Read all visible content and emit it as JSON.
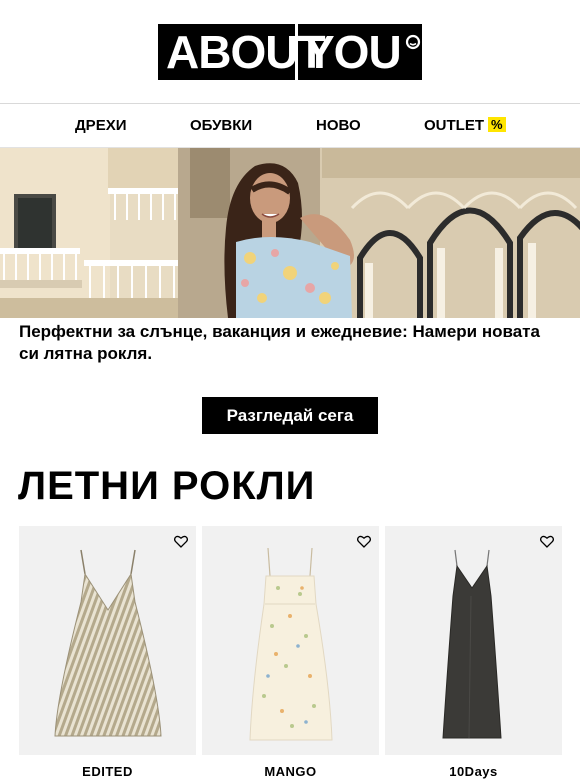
{
  "header": {
    "logo_left": "ABOUT",
    "logo_right": "YOU"
  },
  "nav": {
    "items": [
      {
        "label": "ДРЕХИ"
      },
      {
        "label": "ОБУВКИ"
      },
      {
        "label": "НОВО"
      },
      {
        "label": "OUTLET",
        "badge": "%"
      }
    ]
  },
  "hero": {
    "text": "Перфектни за слънце, ваканция и ежедневие: Намери новата си лятна рокля.",
    "cta_label": "Разгледай сега"
  },
  "section": {
    "title": "ЛЕТНИ РОКЛИ"
  },
  "products": [
    {
      "brand": "EDITED",
      "icon": "heart-outline-icon"
    },
    {
      "brand": "MANGO",
      "icon": "heart-outline-icon"
    },
    {
      "brand": "10Days",
      "icon": "heart-outline-icon"
    }
  ],
  "colors": {
    "accent_yellow": "#ffe500",
    "black": "#000000",
    "tile_background": "#f1f1f1"
  }
}
